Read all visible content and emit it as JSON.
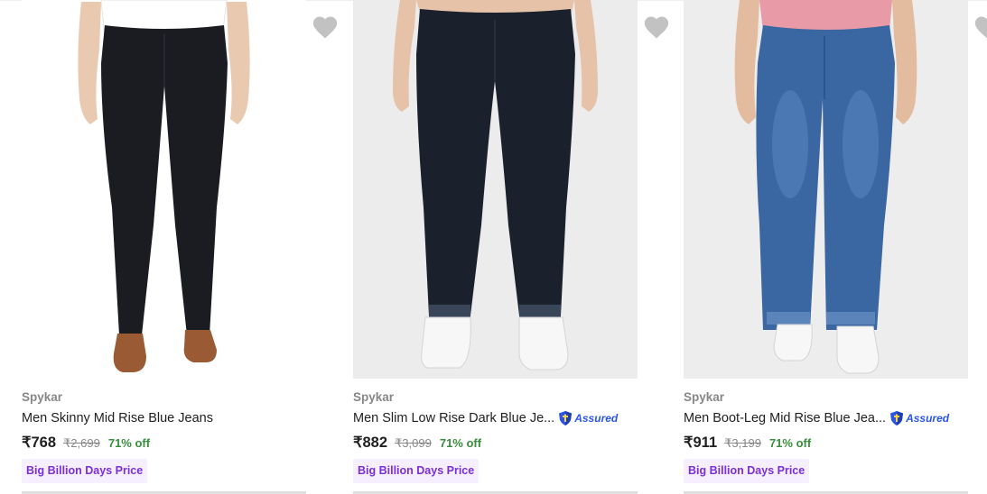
{
  "colors": {
    "background": "#ffffff",
    "brand_text": "#878787",
    "title_text": "#212121",
    "discount_green": "#388e3c",
    "deal_badge_bg": "#f5efff",
    "deal_badge_text": "#7b2fd4",
    "assured_blue": "#2a55e5"
  },
  "products": [
    {
      "brand": "Spykar",
      "title": "Men Skinny Mid Rise Blue Jeans",
      "assured": false,
      "price": "₹768",
      "mrp": "₹2,699",
      "discount": "71% off",
      "deal_label": "Big Billion Days Price",
      "wishlist_icon": "heart-icon"
    },
    {
      "brand": "Spykar",
      "title": "Men Slim Low Rise Dark Blue Je...",
      "assured": true,
      "assured_label": "Assured",
      "price": "₹882",
      "mrp": "₹3,099",
      "discount": "71% off",
      "deal_label": "Big Billion Days Price",
      "wishlist_icon": "heart-icon"
    },
    {
      "brand": "Spykar",
      "title": "Men Boot-Leg Mid Rise Blue Jea...",
      "assured": true,
      "assured_label": "Assured",
      "price": "₹911",
      "mrp": "₹3,199",
      "discount": "71% off",
      "deal_label": "Big Billion Days Price",
      "wishlist_icon": "heart-icon"
    }
  ]
}
